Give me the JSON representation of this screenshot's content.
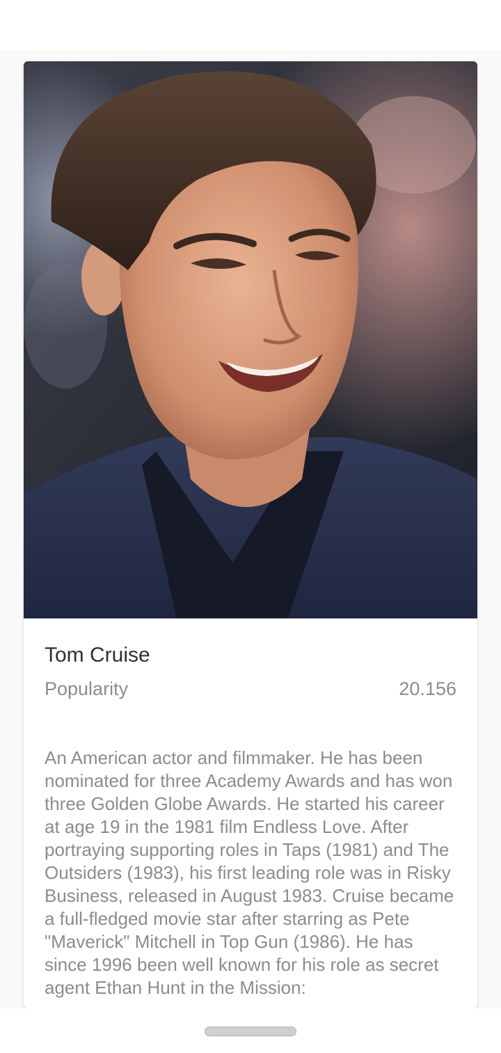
{
  "person": {
    "name": "Tom Cruise",
    "popularity_label": "Popularity",
    "popularity_value": "20.156",
    "biography": "An American actor and filmmaker. He has been nominated for three Academy Awards and has won three Golden Globe Awards. He started his career at age 19 in the 1981 film Endless Love. After portraying supporting roles in Taps (1981) and The Outsiders (1983), his first leading role was in Risky Business, released in August 1983. Cruise became a full-fledged movie star after starring as Pete \"Maverick\" Mitchell in Top Gun (1986). He has since 1996 been well known for his role as secret agent Ethan Hunt in the Mission:"
  },
  "colors": {
    "name_text": "#263238",
    "secondary_text": "#8c8c8c",
    "card_bg": "#ffffff",
    "page_bg": "#f9f9f9"
  }
}
